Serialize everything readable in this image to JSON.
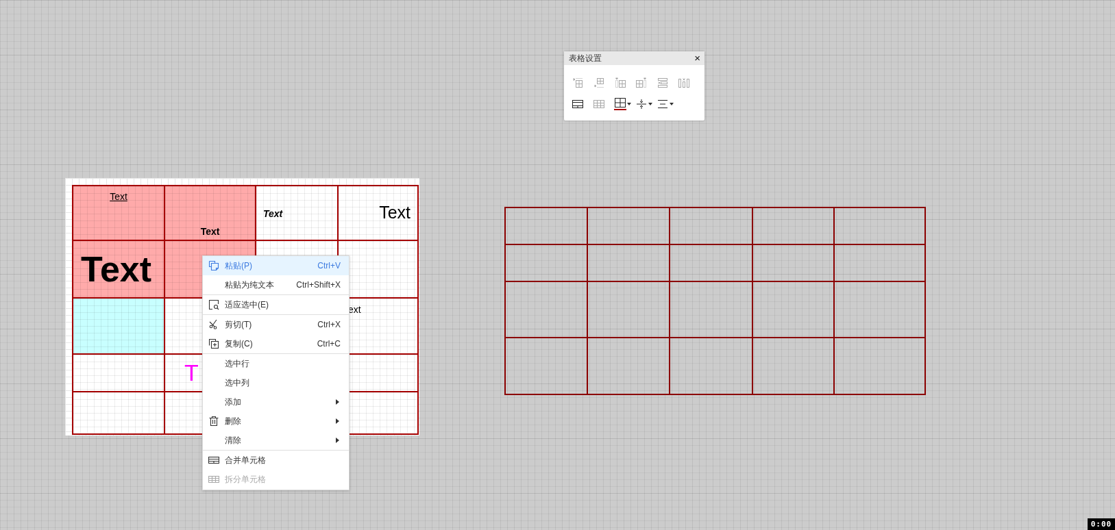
{
  "table_settings_panel": {
    "title": "表格设置",
    "close": "×",
    "tool_rows": [
      [
        {
          "kind": "insert-row-above",
          "disabled": true,
          "dropdown": false
        },
        {
          "kind": "insert-row-below",
          "disabled": true,
          "dropdown": false
        },
        {
          "kind": "insert-column-left",
          "disabled": true,
          "dropdown": false
        },
        {
          "kind": "insert-column-right",
          "disabled": true,
          "dropdown": false
        },
        {
          "kind": "delete-row",
          "disabled": true,
          "dropdown": false
        },
        {
          "kind": "delete-column",
          "disabled": true,
          "dropdown": false
        }
      ],
      [
        {
          "kind": "merge-cells",
          "disabled": false,
          "dropdown": false
        },
        {
          "kind": "split-cells",
          "disabled": true,
          "dropdown": false
        },
        {
          "kind": "borders",
          "disabled": false,
          "dropdown": true,
          "color": "#aa0000"
        },
        {
          "kind": "vertical-align",
          "disabled": false,
          "dropdown": true
        },
        {
          "kind": "text-align",
          "disabled": false,
          "dropdown": true
        }
      ]
    ]
  },
  "table": {
    "rows": [
      [
        {
          "text": "Text",
          "kind": "underlined",
          "color": "#ffaaaa"
        },
        {
          "text": "Text",
          "kind": "bold",
          "color": "#ffaaaa"
        },
        {
          "text": "Text",
          "kind": "bold-italic",
          "color": "#ffffff"
        },
        {
          "text": "Text",
          "kind": "large",
          "color": "#ffffff"
        }
      ],
      [
        {
          "text": "Text",
          "kind": "huge",
          "color": "#ffaaaa"
        },
        {
          "color": "#ffaaaa"
        },
        {
          "color": "#ffffff"
        },
        {
          "color": "#ffffff"
        }
      ],
      [
        {
          "color": "#c8ffff"
        },
        {
          "color": "#ffffff"
        },
        null,
        {
          "text": "ext",
          "kind": "partial",
          "color": "#ffffff"
        }
      ],
      [
        {
          "color": "#ffffff"
        },
        {
          "text": "T",
          "kind": "accent",
          "color": "#ffffff"
        },
        null,
        {
          "color": "#ffffff"
        }
      ],
      [
        {
          "color": "#ffffff"
        },
        {
          "color": "#ffffff"
        },
        null,
        {
          "color": "#ffffff"
        }
      ]
    ]
  },
  "context_menu": {
    "groups": [
      [
        {
          "label": "粘贴(P)",
          "shortcut": "Ctrl+V",
          "kind": "paste",
          "selected": true,
          "disabled": false,
          "submenu": false
        },
        {
          "label": "粘贴为纯文本",
          "shortcut": "Ctrl+Shift+X",
          "kind": "plain",
          "selected": false,
          "disabled": false,
          "submenu": false
        }
      ],
      [
        {
          "label": "适应选中(E)",
          "kind": "fit",
          "selected": false,
          "disabled": false,
          "submenu": false
        }
      ],
      [
        {
          "label": "剪切(T)",
          "shortcut": "Ctrl+X",
          "kind": "cut",
          "selected": false,
          "disabled": false,
          "submenu": false
        },
        {
          "label": "复制(C)",
          "shortcut": "Ctrl+C",
          "kind": "copy",
          "selected": false,
          "disabled": false,
          "submenu": false
        }
      ],
      [
        {
          "label": "选中行",
          "kind": "plain",
          "selected": false,
          "disabled": false,
          "submenu": false
        },
        {
          "label": "选中列",
          "kind": "plain",
          "selected": false,
          "disabled": false,
          "submenu": false
        },
        {
          "label": "添加",
          "kind": "plain",
          "selected": false,
          "disabled": false,
          "submenu": true
        },
        {
          "label": "删除",
          "kind": "delete",
          "selected": false,
          "disabled": false,
          "submenu": true
        },
        {
          "label": "清除",
          "kind": "plain",
          "selected": false,
          "disabled": false,
          "submenu": true
        }
      ],
      [
        {
          "label": "合并单元格",
          "kind": "merge",
          "selected": false,
          "disabled": false,
          "submenu": false
        },
        {
          "label": "拆分单元格",
          "kind": "split",
          "selected": false,
          "disabled": true,
          "submenu": false
        }
      ]
    ]
  },
  "timer": "0:00"
}
